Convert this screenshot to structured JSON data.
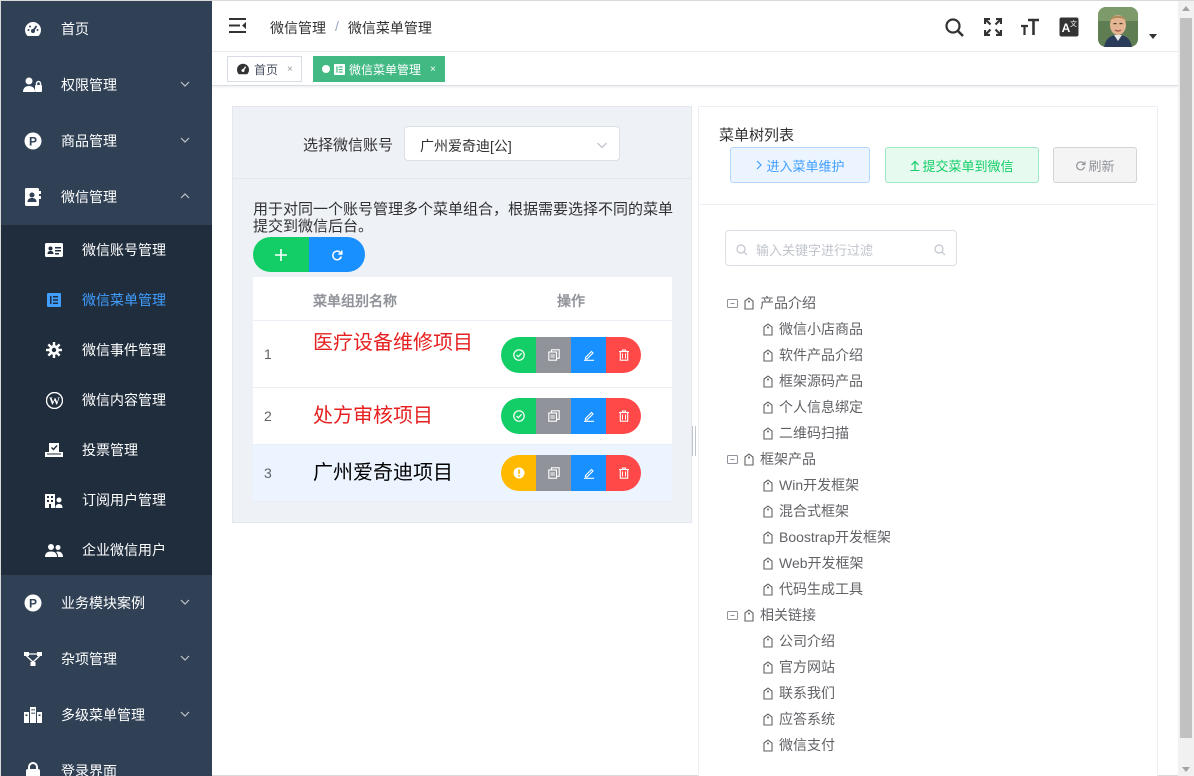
{
  "sidebar": {
    "items": [
      {
        "label": "首页",
        "icon": "dashboard-icon"
      },
      {
        "label": "权限管理",
        "icon": "user-lock-icon"
      },
      {
        "label": "商品管理",
        "icon": "p-circle-icon"
      },
      {
        "label": "微信管理",
        "icon": "contact-card-icon"
      },
      {
        "label": "业务模块案例",
        "icon": "p-circle-icon"
      },
      {
        "label": "杂项管理",
        "icon": "network-icon"
      },
      {
        "label": "多级菜单管理",
        "icon": "building-icon"
      },
      {
        "label": "登录界面",
        "icon": "lock-icon"
      }
    ],
    "wechat_sub": [
      {
        "label": "微信账号管理",
        "icon": "id-card-icon"
      },
      {
        "label": "微信菜单管理",
        "icon": "menu-doc-icon"
      },
      {
        "label": "微信事件管理",
        "icon": "gear-icon"
      },
      {
        "label": "微信内容管理",
        "icon": "wordpress-icon"
      },
      {
        "label": "投票管理",
        "icon": "vote-icon"
      },
      {
        "label": "订阅用户管理",
        "icon": "building-user-icon"
      },
      {
        "label": "企业微信用户",
        "icon": "users-icon"
      }
    ]
  },
  "header": {
    "breadcrumb": [
      "微信管理",
      "微信菜单管理"
    ]
  },
  "tags": [
    {
      "label": "首页",
      "close": "×"
    },
    {
      "label": "微信菜单管理",
      "close": "×"
    }
  ],
  "left": {
    "account_label": "选择微信账号",
    "account_value": "广州爱奇迪[公]",
    "description": "用于对同一个账号管理多个菜单组合，根据需要选择不同的菜单提交到微信后台。",
    "table": {
      "col_name": "菜单组别名称",
      "col_ops": "操作",
      "rows": [
        {
          "index": "1",
          "name": "医疗设备维修项目",
          "status": "ok",
          "color": "#e62020"
        },
        {
          "index": "2",
          "name": "处方审核项目",
          "status": "ok",
          "color": "#e62020"
        },
        {
          "index": "3",
          "name": "广州爱奇迪项目",
          "status": "warn",
          "color": "#000000"
        }
      ]
    }
  },
  "right": {
    "title": "菜单树列表",
    "btn_enter": "进入菜单维护",
    "btn_submit": "提交菜单到微信",
    "btn_refresh": "刷新",
    "filter_placeholder": "输入关键字进行过滤",
    "tree": [
      {
        "label": "产品介绍",
        "children": [
          "微信小店商品",
          "软件产品介绍",
          "框架源码产品",
          "个人信息绑定",
          "二维码扫描"
        ]
      },
      {
        "label": "框架产品",
        "children": [
          "Win开发框架",
          "混合式框架",
          "Boostrap开发框架",
          "Web开发框架",
          "代码生成工具"
        ]
      },
      {
        "label": "相关链接",
        "children": [
          "公司介绍",
          "官方网站",
          "联系我们",
          "应答系统",
          "微信支付"
        ]
      }
    ]
  }
}
